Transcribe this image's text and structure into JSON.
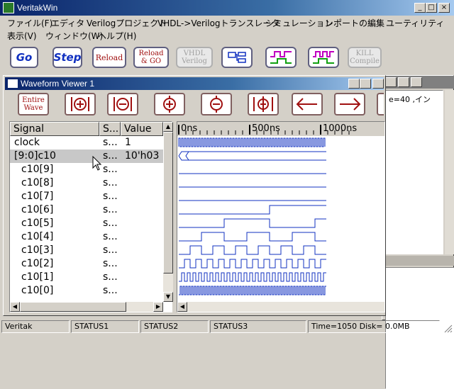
{
  "app": {
    "title": "VeritakWin"
  },
  "caption_buttons": {
    "minimize": "_",
    "maximize": "□",
    "close": "×"
  },
  "menu": {
    "row1": [
      {
        "label": "ファイル(F)"
      },
      {
        "label": "エディタ"
      },
      {
        "label": "Verilogプロジェクト"
      },
      {
        "label": "VHDL->Verilogトランスレータ"
      },
      {
        "label": "シミュレーション"
      },
      {
        "label": "レポートの編集"
      },
      {
        "label": "ユーティリティ"
      }
    ],
    "row2": [
      {
        "label": "表示(V)"
      },
      {
        "label": "ウィンドウ(W)"
      },
      {
        "label": "ヘルプ(H)"
      }
    ]
  },
  "toolbar": {
    "go": "Go",
    "step": "Step",
    "reload": "Reload",
    "reload_go_1": "Reload",
    "reload_go_2": "& GO",
    "vhdl_1": "VHDL",
    "vhdl_2": "Verilog",
    "kill_1": "KILL",
    "kill_2": "Compile"
  },
  "background_window": {
    "text": "e=40 ,イン"
  },
  "waveform_viewer": {
    "title": "Waveform Viewer 1",
    "entire_1": "Entire",
    "entire_2": "Wave",
    "columns": {
      "signal": "Signal",
      "status": "S...",
      "value": "Value"
    },
    "rows": [
      {
        "name": "clock",
        "status": "s...",
        "value": "1"
      },
      {
        "name": "[9:0]c10",
        "status": "s...",
        "value": "10'h03"
      },
      {
        "name": "c10[9]",
        "status": "s...",
        "value": ""
      },
      {
        "name": "c10[8]",
        "status": "s...",
        "value": ""
      },
      {
        "name": "c10[7]",
        "status": "s...",
        "value": ""
      },
      {
        "name": "c10[6]",
        "status": "s...",
        "value": ""
      },
      {
        "name": "c10[5]",
        "status": "s...",
        "value": ""
      },
      {
        "name": "c10[4]",
        "status": "s...",
        "value": ""
      },
      {
        "name": "c10[3]",
        "status": "s...",
        "value": ""
      },
      {
        "name": "c10[2]",
        "status": "s...",
        "value": ""
      },
      {
        "name": "c10[1]",
        "status": "s...",
        "value": ""
      },
      {
        "name": "c10[0]",
        "status": "s...",
        "value": ""
      }
    ],
    "time_labels": [
      "0ns",
      "500ns",
      "1000ns"
    ]
  },
  "statusbar": {
    "app": "Veritak",
    "status1": "STATUS1",
    "status2": "STATUS2",
    "status3": "STATUS3",
    "info": "Time=1050 Disk= 0.0MB"
  }
}
